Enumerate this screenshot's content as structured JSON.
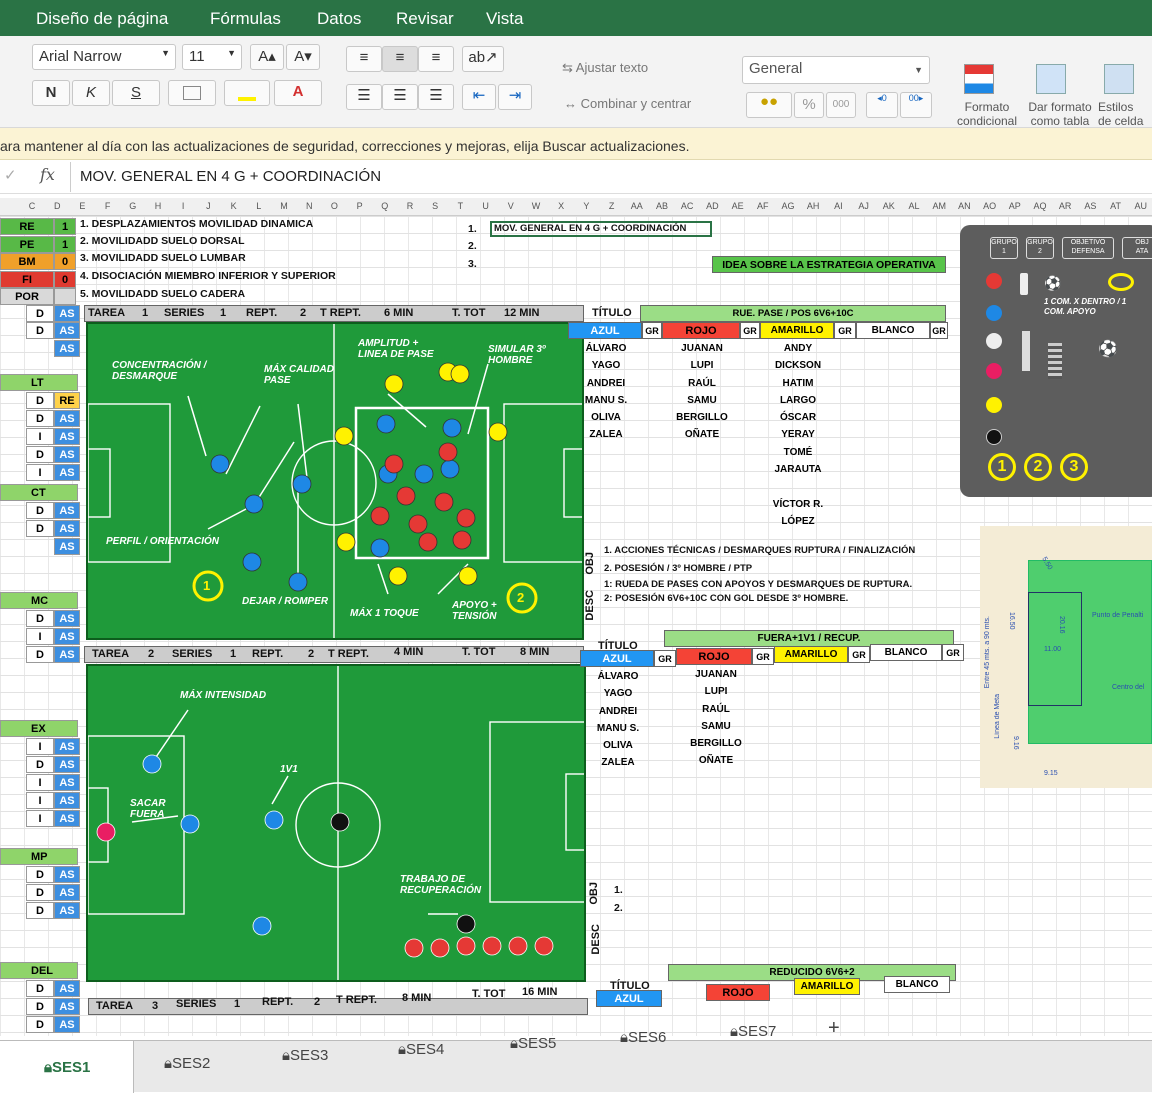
{
  "menu": [
    "Diseño de página",
    "Fórmulas",
    "Datos",
    "Revisar",
    "Vista"
  ],
  "ribbon": {
    "font_name": "Arial Narrow",
    "font_size": "11",
    "grow_font": "A▴",
    "shrink_font": "A▾",
    "bold": "N",
    "italic": "K",
    "underline": "S",
    "wrap_text": "Ajustar texto",
    "merge_center": "Combinar y centrar",
    "number_format": "General",
    "percent": "%",
    "thousands": "000",
    "cond_format": "Formato\ncondicional",
    "format_table": "Dar formato\ncomo tabla",
    "cell_styles": "Estilos\nde celda"
  },
  "notice": "ara mantener al día con las actualizaciones de seguridad, correcciones y mejoras, elija Buscar actualizaciones.",
  "formula_bar": {
    "fx": "fx",
    "content": "MOV. GENERAL EN 4 G + COORDINACIÓN"
  },
  "columns": [
    "C",
    "D",
    "E",
    "F",
    "G",
    "H",
    "I",
    "J",
    "K",
    "L",
    "M",
    "N",
    "O",
    "P",
    "Q",
    "R",
    "S",
    "T",
    "U",
    "V",
    "W",
    "X",
    "Y",
    "Z",
    "AA",
    "AB",
    "AC",
    "AD",
    "AE",
    "AF",
    "AG",
    "AH",
    "AI",
    "AJ",
    "AK",
    "AL",
    "AM",
    "AN",
    "AO",
    "AP",
    "AQ",
    "AR",
    "AS",
    "AT",
    "AU"
  ],
  "left": {
    "legend": [
      {
        "code": "RE",
        "num": "1",
        "color": "#58b947"
      },
      {
        "code": "PE",
        "num": "1",
        "color": "#58b947"
      },
      {
        "code": "BM",
        "num": "0",
        "color": "#f0a02a"
      },
      {
        "code": "FI",
        "num": "0",
        "color": "#e03a30"
      },
      {
        "code": "POR",
        "num": "",
        "color": "#d9d9d9"
      }
    ],
    "mobility": [
      "1.  DESPLAZAMIENTOS MOVILIDAD DINAMICA",
      "2.  MOVILIDADD SUELO DORSAL",
      "3.  MOVILIDADD SUELO LUMBAR",
      "4.  DISOCIACIÓN MIEMBRO INFERIOR Y SUPERIOR",
      "5.  MOVILIDADD SUELO CADERA"
    ],
    "groups": [
      "LT",
      "CT",
      "MC",
      "EX",
      "MP",
      "DEL"
    ],
    "cd": "D",
    "ci": "I",
    "as": "AS",
    "re": "RE"
  },
  "objectives": {
    "n1": "1.",
    "n2": "2.",
    "n3": "3.",
    "item1": "MOV. GENERAL EN 4 G + COORDINACIÓN",
    "idea": "IDEA SOBRE LA ESTRATEGIA OPERATIVA"
  },
  "task1": {
    "tarea": "TAREA",
    "n": "1",
    "series_l": "SERIES",
    "series": "1",
    "rept_l": "REPT.",
    "rept": "2",
    "trept_l": "T REPT.",
    "trept": "6 MIN",
    "ttot_l": "T. TOT",
    "ttot": "12 MIN",
    "title_l": "TÍTULO",
    "title": "RUE. PASE / POS 6V6+10C",
    "labels": {
      "concentracion": "CONCENTRACIÓN /\nDESMARQUE",
      "max_calidad": "MÁX CALIDAD\nPASE",
      "amplitud": "AMPLITUD +\nLINEA DE PASE",
      "simular": "SIMULAR 3º\nHOMBRE",
      "perfil": "PERFIL / ORIENTACIÓN",
      "dejar": "DEJAR / ROMPER",
      "max1": "MÁX 1 TOQUE",
      "apoyo": "APOYO +\nTENSIÓN",
      "c1": "1",
      "c2": "2"
    },
    "teams": {
      "azul": "AZUL",
      "gr": "GR",
      "rojo": "ROJO",
      "amarillo": "AMARILLO",
      "blanco": "BLANCO",
      "azul_players": [
        "ÁLVARO",
        "YAGO",
        "ANDREI",
        "MANU S.",
        "OLIVA",
        "ZALEA"
      ],
      "rojo_players": [
        "JUANAN",
        "LUPI",
        "RAÚL",
        "SAMU",
        "BERGILLO",
        "OÑATE"
      ],
      "amarillo_players": [
        "ANDY",
        "DICKSON",
        "HATIM",
        "LARGO",
        "ÓSCAR",
        "YERAY",
        "TOMÉ",
        "JARAUTA",
        "",
        "VÍCTOR R.",
        "LÓPEZ"
      ]
    },
    "obj_label": "OBJ",
    "desc_label": "DESC",
    "obj1": "1.   ACCIONES TÉCNICAS / DESMARQUES RUPTURA / FINALIZACIÓN",
    "obj2": "2.   POSESIÓN / 3º HOMBRE / PTP",
    "desc1": "1: RUEDA DE PASES CON APOYOS Y DESMARQUES DE RUPTURA.",
    "desc2": "2: POSESIÓN 6V6+10C CON GOL DESDE 3º HOMBRE."
  },
  "task2": {
    "tarea": "TAREA",
    "n": "2",
    "series_l": "SERIES",
    "series": "1",
    "rept_l": "REPT.",
    "rept": "2",
    "trept_l": "T REPT.",
    "trept": "4 MIN",
    "ttot_l": "T. TOT",
    "ttot": "8 MIN",
    "title_l": "TÍTULO",
    "title": "FUERA+1V1 / RECUP.",
    "labels": {
      "max_int": "MÁX INTENSIDAD",
      "sacar": "SACAR\nFUERA",
      "uno": "1V1",
      "trabajo": "TRABAJO DE\nRECUPERACIÓN"
    },
    "teams": {
      "azul": "AZUL",
      "gr": "GR",
      "rojo": "ROJO",
      "amarillo": "AMARILLO",
      "blanco": "BLANCO",
      "azul_players": [
        "ÁLVARO",
        "YAGO",
        "ANDREI",
        "MANU S.",
        "OLIVA",
        "ZALEA"
      ],
      "rojo_players": [
        "JUANAN",
        "LUPI",
        "RAÚL",
        "SAMU",
        "BERGILLO",
        "OÑATE"
      ]
    },
    "obj_label": "OBJ",
    "desc_label": "DESC",
    "obj1": "1.",
    "obj2": "2."
  },
  "task3": {
    "tarea": "TAREA",
    "n": "3",
    "series_l": "SERIES",
    "series": "1",
    "rept_l": "REPT.",
    "rept": "2",
    "trept_l": "T REPT.",
    "trept": "8 MIN",
    "ttot_l": "T. TOT",
    "ttot": "16 MIN",
    "title_l": "TÍTULO",
    "title": "REDUCIDO 6V6+2",
    "azul": "AZUL",
    "gr": "GR",
    "rojo": "ROJO",
    "amarillo": "AMARILLO",
    "blanco": "BLANCO"
  },
  "panel": {
    "grupo1": "GRUPO\n1",
    "grupo2": "GRUPO\n2",
    "defensa": "OBJETIVO\nDEFENSA",
    "ata": "OBJ\nATA",
    "com1": "1 COM. X DENTRO / 1\nCOM. APOYO",
    "n1": "1",
    "n2": "2",
    "n3": "3"
  },
  "diagram": {
    "dim_left": "Entre 45 mts. a 90 mts.",
    "dim_penalty": "Línea de Meta",
    "penal": "Punto de Penalti",
    "centro": "Centro del",
    "m1650": "16.50",
    "m1100": "11.00",
    "m916": "9.16",
    "m915": "9.15",
    "m2016": "20.16",
    "m550": "5.50"
  },
  "sheets": [
    "SES1",
    "SES2",
    "SES3",
    "SES4",
    "SES5",
    "SES6",
    "SES7",
    "+"
  ],
  "colors": {
    "green_menu": "#2a7345",
    "pitch": "#1f9a3a",
    "blue": "#1e88e5",
    "red": "#e53935",
    "yellow": "#fff200"
  }
}
